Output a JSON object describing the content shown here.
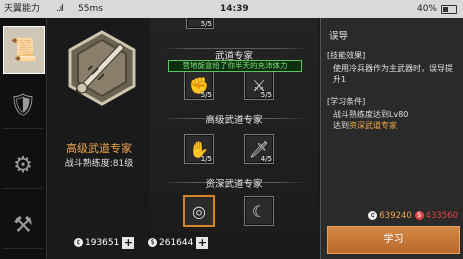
{
  "status_bar": {
    "carrier": "天翼能力",
    "signal": "..ıl",
    "speed": "55ms",
    "time": "14:39",
    "battery": "40%"
  },
  "sidebar": {
    "tabs": [
      {
        "icon": "scroll-icon",
        "glyph": "📜",
        "active": true
      },
      {
        "icon": "shield-icon",
        "glyph": "🛡",
        "active": false
      },
      {
        "icon": "gear-icon",
        "glyph": "⚙",
        "active": false
      },
      {
        "icon": "crossed-tools-icon",
        "glyph": "⚒",
        "active": false
      }
    ]
  },
  "profile": {
    "title": "高级武道专家",
    "level": "战斗熟练度:81级"
  },
  "tree": {
    "tooltip": "营地旋盒给了你半天的充沛体力",
    "tiers": [
      {
        "label": "武道专家",
        "skills": [
          {
            "icon": "fist-icon",
            "count": "5/5"
          },
          {
            "icon": "slash-icon",
            "count": "5/5"
          }
        ]
      },
      {
        "label": "高级武道专家",
        "skills": [
          {
            "icon": "strike-icon",
            "count": "1/5"
          },
          {
            "icon": "blade-icon",
            "count": "4/5"
          }
        ]
      },
      {
        "label": "资深武道专家",
        "skills": [
          {
            "icon": "target-icon",
            "count": ""
          },
          {
            "icon": "claw-icon",
            "count": ""
          }
        ]
      }
    ],
    "top_partial": {
      "count": "5/5"
    }
  },
  "currencies": [
    {
      "icon": "gold-coin-icon",
      "symbol": "¢",
      "amount": "193651"
    },
    {
      "icon": "silver-coin-icon",
      "symbol": "$",
      "amount": "261644"
    }
  ],
  "detail": {
    "heading": "误导",
    "effect_title": "[技能效果]",
    "effect_text": "使用冷兵器作为主武器时，误导提升1",
    "req_title": "[学习条件]",
    "req_line1": "战斗熟练度达到Lv80",
    "req_prefix": "达到",
    "req_highlight": "资深武道专家",
    "cost_a": "639240",
    "cost_b": "433560",
    "learn_label": "学习"
  },
  "colors": {
    "accent_orange": "#f0a84b",
    "cost_red": "#e24545",
    "tooltip_green": "#7be37b"
  }
}
